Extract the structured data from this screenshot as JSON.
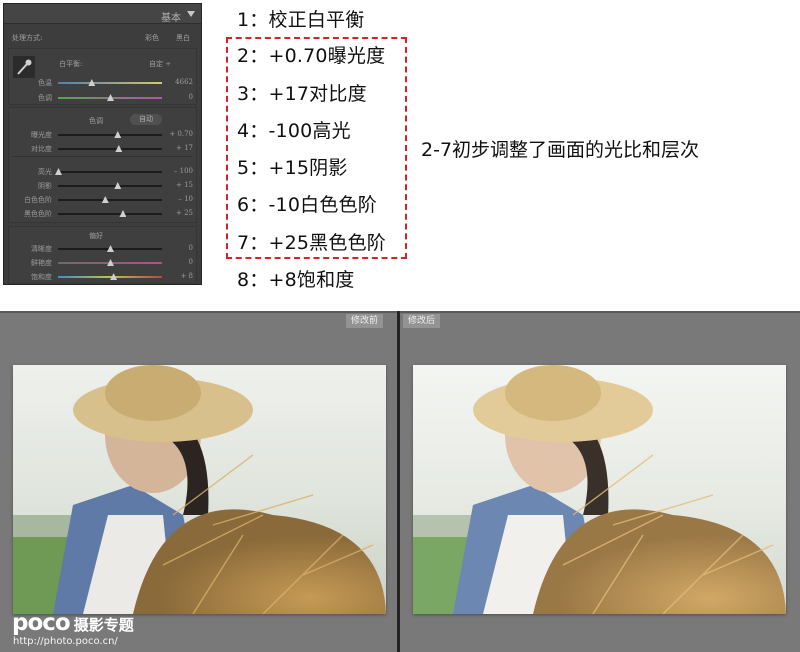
{
  "panel": {
    "title": "基本",
    "treatment": {
      "label": "处理方式:",
      "color": "彩色",
      "bw": "黑白"
    },
    "wb": {
      "label": "白平衡:",
      "value": "自定 ÷"
    },
    "sliders_wb": [
      {
        "label": "色温",
        "value": "4662",
        "pos": 0.32,
        "track": "temp"
      },
      {
        "label": "色调",
        "value": "0",
        "pos": 0.5,
        "track": "tint"
      }
    ],
    "tone": {
      "label": "色调",
      "auto": "自动"
    },
    "sliders_tone": [
      {
        "label": "曝光度",
        "value": "+ 0.70",
        "pos": 0.57,
        "track": "plain"
      },
      {
        "label": "对比度",
        "value": "+ 17",
        "pos": 0.58,
        "track": "plain"
      },
      {
        "label": "高光",
        "value": "– 100",
        "pos": 0.0,
        "track": "plain"
      },
      {
        "label": "阴影",
        "value": "+ 15",
        "pos": 0.57,
        "track": "plain"
      },
      {
        "label": "白色色阶",
        "value": "– 10",
        "pos": 0.45,
        "track": "plain"
      },
      {
        "label": "黑色色阶",
        "value": "+ 25",
        "pos": 0.62,
        "track": "plain"
      }
    ],
    "presence": {
      "label": "偏好"
    },
    "sliders_presence": [
      {
        "label": "清晰度",
        "value": "0",
        "pos": 0.5,
        "track": "plain"
      },
      {
        "label": "鲜艳度",
        "value": "0",
        "pos": 0.5,
        "track": "vib"
      },
      {
        "label": "饱和度",
        "value": "+ 8",
        "pos": 0.53,
        "track": "sat"
      }
    ]
  },
  "steps": [
    "1：校正白平衡",
    "2：+0.70曝光度",
    "3：+17对比度",
    "4：-100高光",
    "5：+15阴影",
    "6：-10白色色阶",
    "7：+25黑色色阶",
    "8：+8饱和度"
  ],
  "summary": "2-7初步调整了画面的光比和层次",
  "compare": {
    "before_label": "修改前",
    "after_label": "修改后"
  },
  "watermark": {
    "brand": "poco",
    "sub": "摄影专题",
    "url": "http://photo.poco.cn/"
  },
  "colors": {
    "highlight_box": "#d2232a",
    "panel_bg": "#3d3d3d",
    "compare_bg": "#797979"
  }
}
